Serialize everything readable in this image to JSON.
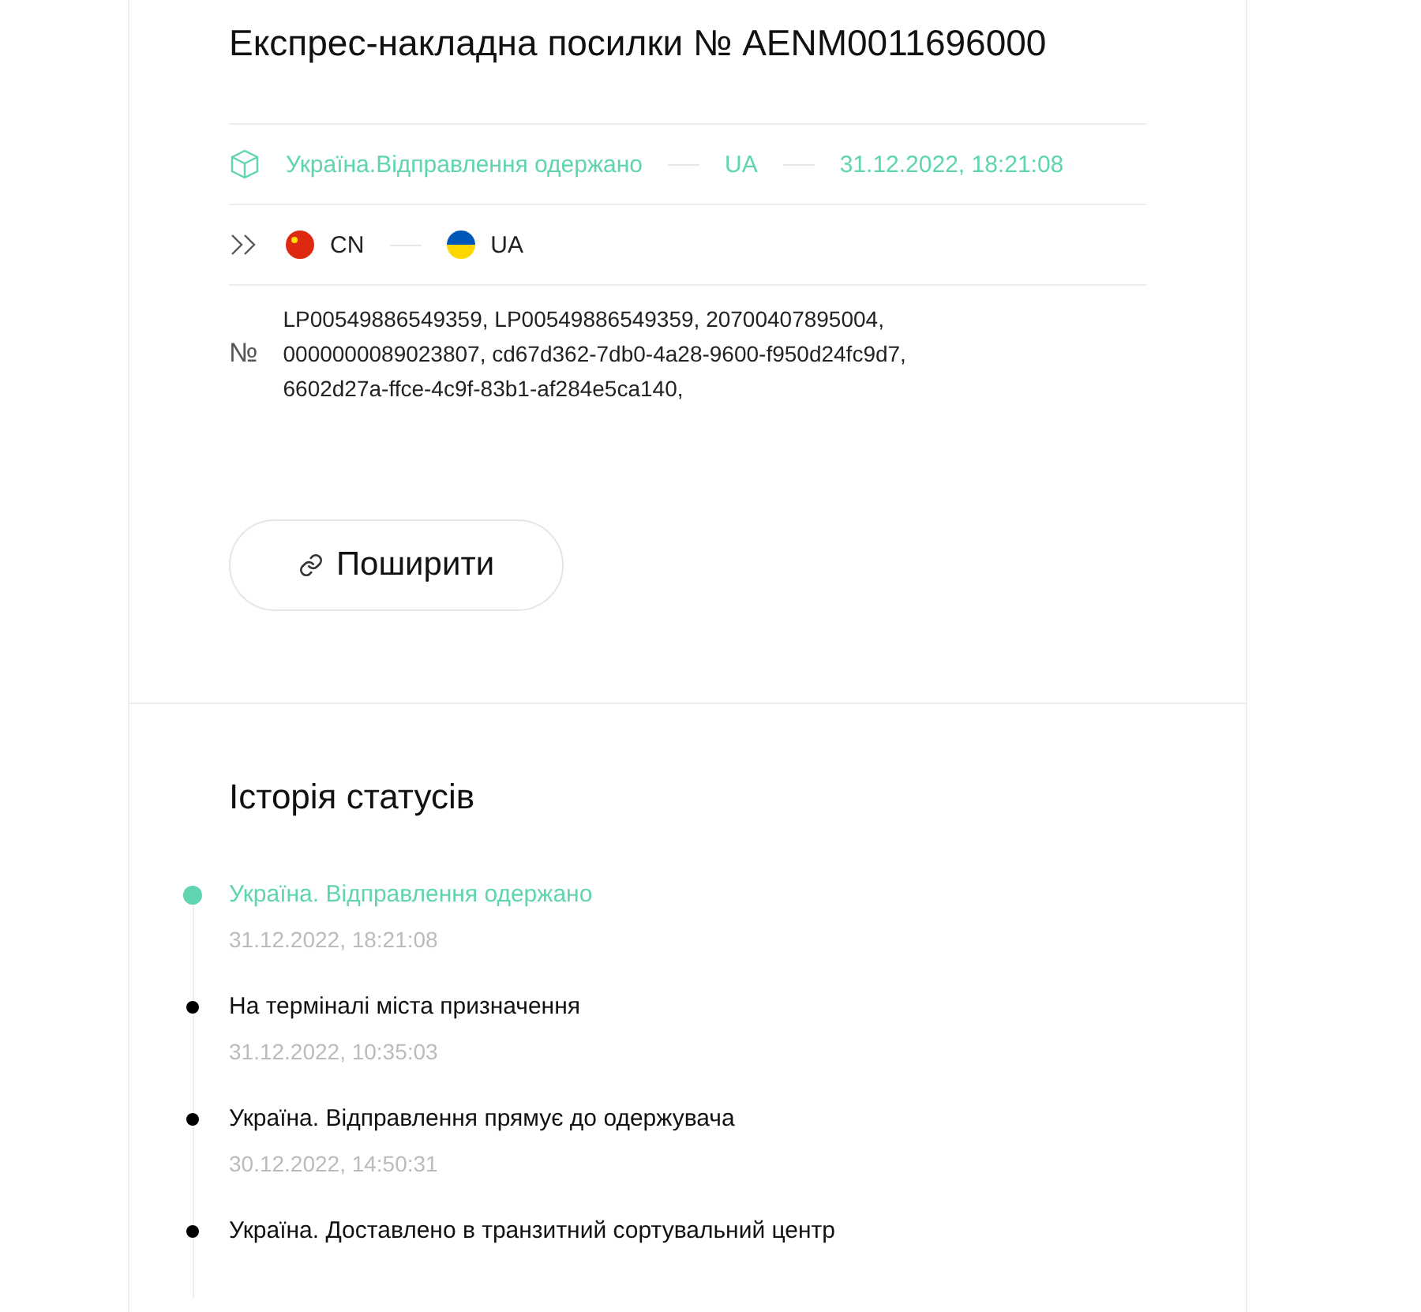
{
  "title": "Експрес-накладна посилки № AENM0011696000",
  "last_status": {
    "text": "Україна.Відправлення одержано",
    "country": "UA",
    "datetime": "31.12.2022, 18:21:08"
  },
  "route": {
    "from": {
      "code": "CN",
      "kind": "cn"
    },
    "to": {
      "code": "UA",
      "kind": "ua"
    }
  },
  "numbers": {
    "symbol": "№",
    "text": "LP00549886549359, LP00549886549359, 20700407895004, 0000000089023807, cd67d362-7db0-4a28-9600-f950d24fc9d7, 6602d27a-ffce-4c9f-83b1-af284e5ca140,"
  },
  "share_button": "Поширити",
  "history": {
    "title": "Історія статусів",
    "items": [
      {
        "status": "Україна. Відправлення одержано",
        "datetime": "31.12.2022, 18:21:08",
        "current": true
      },
      {
        "status": "На терміналі міста призначення",
        "datetime": "31.12.2022, 10:35:03",
        "current": false
      },
      {
        "status": "Україна. Відправлення прямує до одержувача",
        "datetime": "30.12.2022, 14:50:31",
        "current": false
      },
      {
        "status": "Україна. Доставлено в транзитний сортувальний центр",
        "current": false
      }
    ]
  }
}
